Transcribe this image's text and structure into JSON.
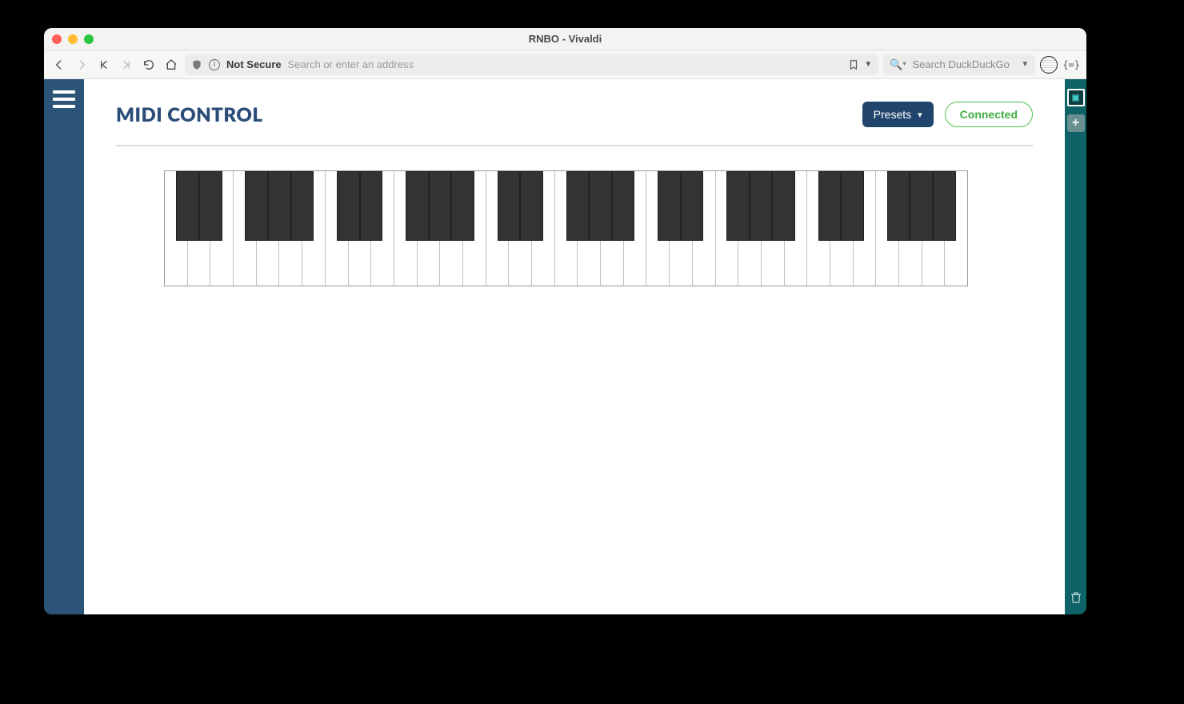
{
  "window": {
    "title": "RNBO - Vivaldi"
  },
  "toolbar": {
    "not_secure": "Not Secure",
    "address_placeholder": "Search or enter an address",
    "search_placeholder": "Search DuckDuckGo"
  },
  "page": {
    "title": "MIDI CONTROL",
    "presets_label": "Presets",
    "status_label": "Connected"
  },
  "keyboard": {
    "white_key_count": 35,
    "black_key_positions_in_wk_units": [
      0.5,
      1.5,
      3.5,
      4.5,
      5.5,
      7.5,
      8.5,
      10.5,
      11.5,
      12.5,
      14.5,
      15.5,
      17.5,
      18.5,
      19.5,
      21.5,
      22.5,
      24.5,
      25.5,
      26.5,
      28.5,
      29.5,
      31.5,
      32.5,
      33.5
    ],
    "note": "positions are centers of black keys measured in white-key widths; layout here is schematic per screenshot"
  },
  "right_rail": {
    "active_tab_glyph": "▣"
  }
}
